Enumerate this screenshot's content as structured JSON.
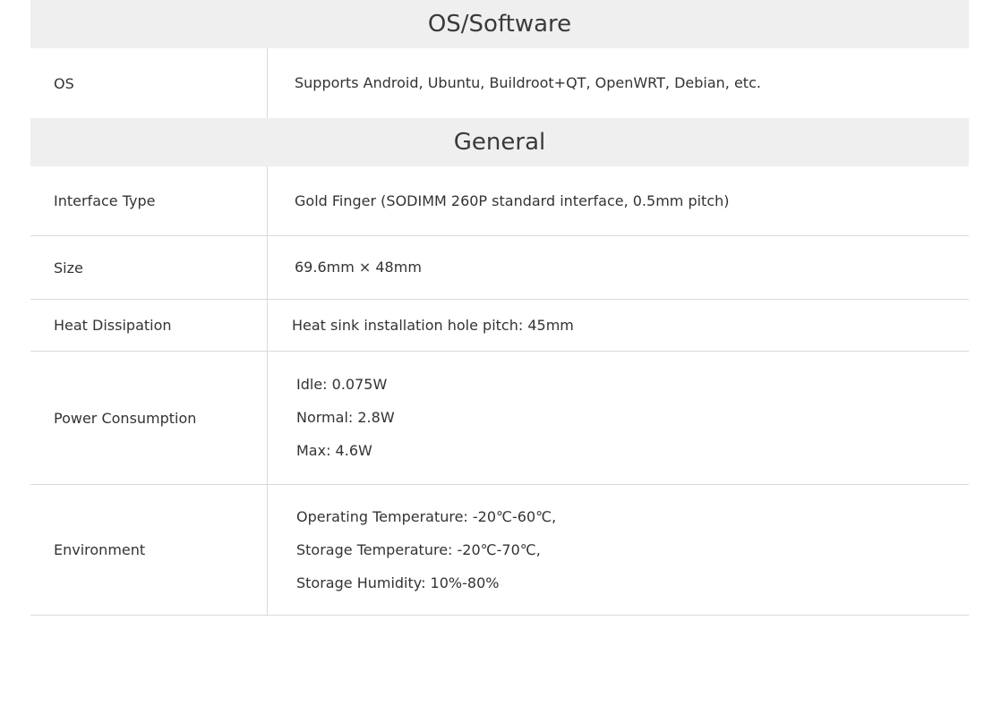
{
  "sections": [
    {
      "title": "OS/Software",
      "rows": [
        {
          "label": "OS",
          "values": [
            "Supports Android, Ubuntu, Buildroot+QT, OpenWRT, Debian, etc."
          ]
        }
      ]
    },
    {
      "title": "General",
      "rows": [
        {
          "label": "Interface Type",
          "values": [
            "Gold Finger (SODIMM 260P standard interface, 0.5mm pitch)"
          ]
        },
        {
          "label": "Size",
          "values": [
            "69.6mm × 48mm"
          ]
        },
        {
          "label": "Heat Dissipation",
          "values": [
            "Heat sink installation hole pitch: 45mm"
          ]
        },
        {
          "label": "Power Consumption",
          "values": [
            "Idle: 0.075W",
            "Normal: 2.8W",
            "Max: 4.6W"
          ]
        },
        {
          "label": "Environment",
          "values": [
            "Operating Temperature: -20℃-60℃,",
            "Storage Temperature: -20℃-70℃,",
            "Storage Humidity: 10%-80%"
          ]
        }
      ]
    }
  ]
}
